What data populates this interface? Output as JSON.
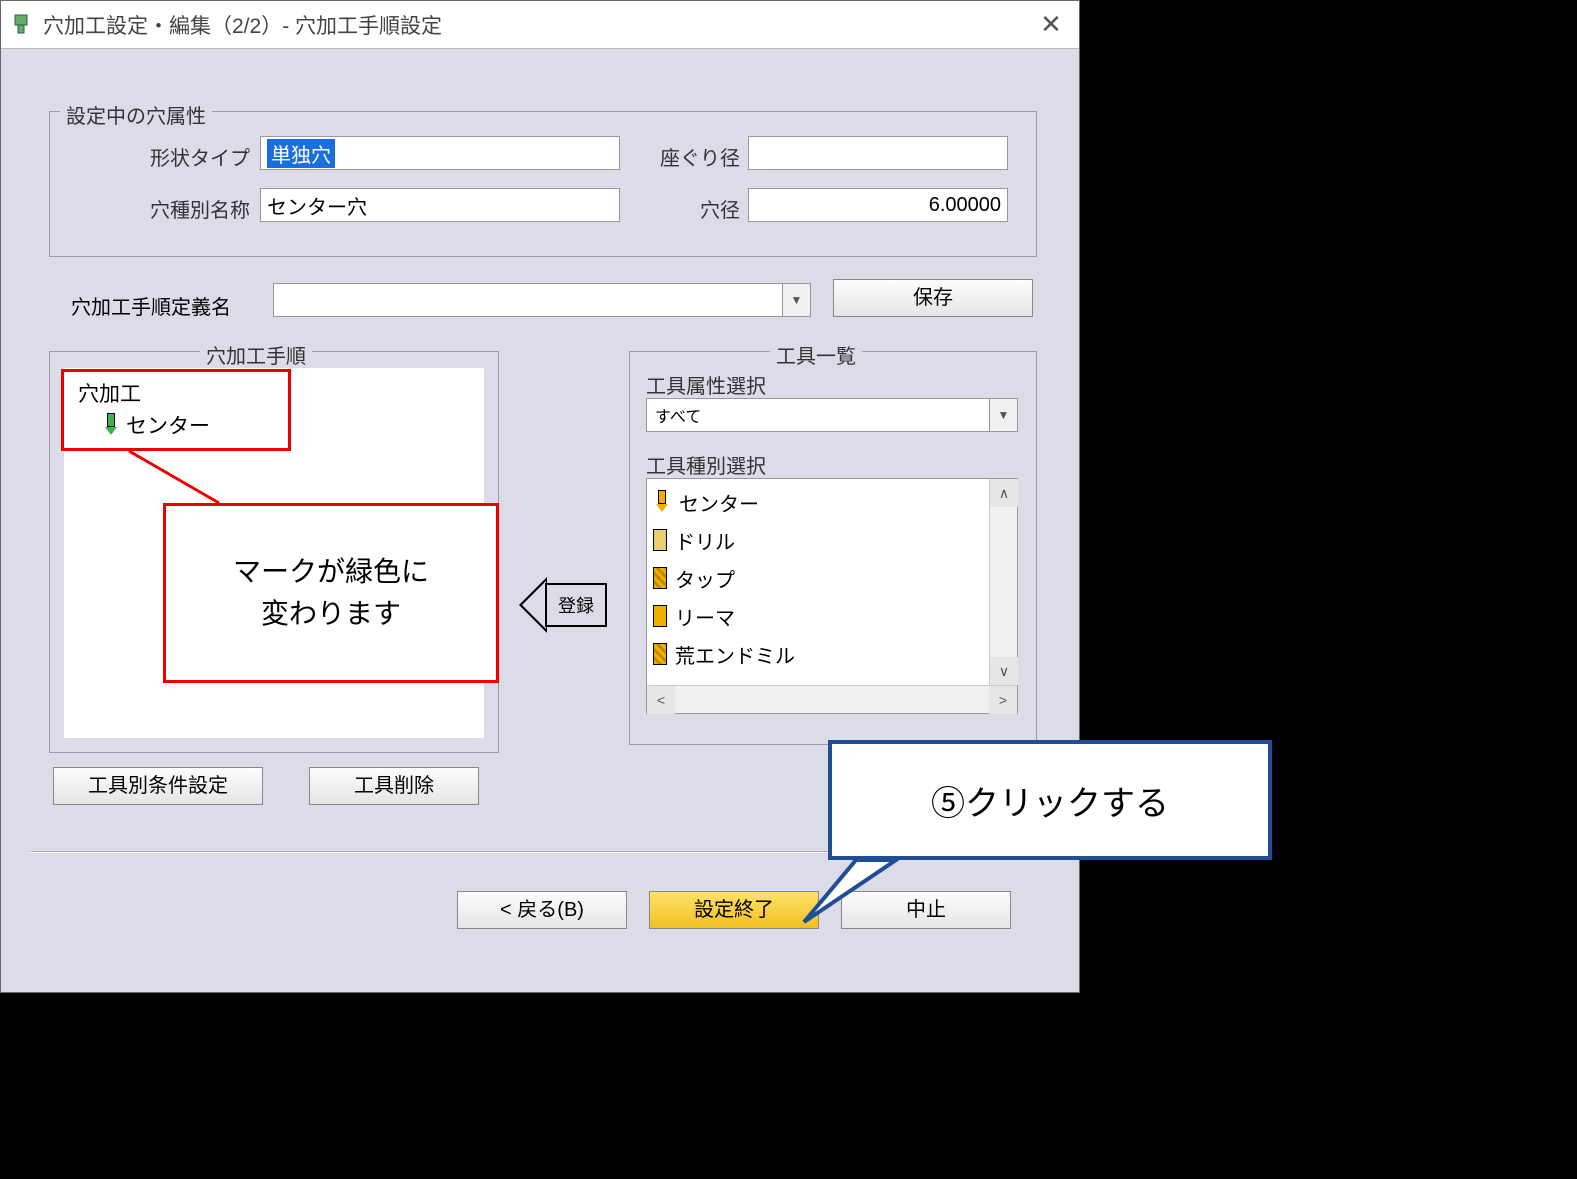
{
  "window": {
    "title": "穴加工設定・編集（2/2）- 穴加工手順設定"
  },
  "attr_group": {
    "legend": "設定中の穴属性",
    "shape_type_label": "形状タイプ",
    "shape_type_value": "単独穴",
    "counterbore_label": "座ぐり径",
    "counterbore_value": "",
    "hole_name_label": "穴種別名称",
    "hole_name_value": "センター穴",
    "hole_dia_label": "穴径",
    "hole_dia_value": "6.00000"
  },
  "def_row": {
    "label": "穴加工手順定義名",
    "value": "",
    "save": "保存"
  },
  "proc_group": {
    "legend": "穴加工手順",
    "root": "穴加工",
    "item": "センター"
  },
  "register_label": "登録",
  "tool_group": {
    "legend": "工具一覧",
    "attr_label": "工具属性選択",
    "attr_value": "すべて",
    "type_label": "工具種別選択",
    "items": [
      "センター",
      "ドリル",
      "タップ",
      "リーマ",
      "荒エンドミル"
    ]
  },
  "buttons": {
    "cond": "工具別条件設定",
    "del": "工具削除",
    "back": "< 戻る(B)",
    "finish": "設定終了",
    "cancel": "中止"
  },
  "callouts": {
    "green_note_l1": "マークが緑色に",
    "green_note_l2": "変わります",
    "step5": "⑤クリックする"
  }
}
